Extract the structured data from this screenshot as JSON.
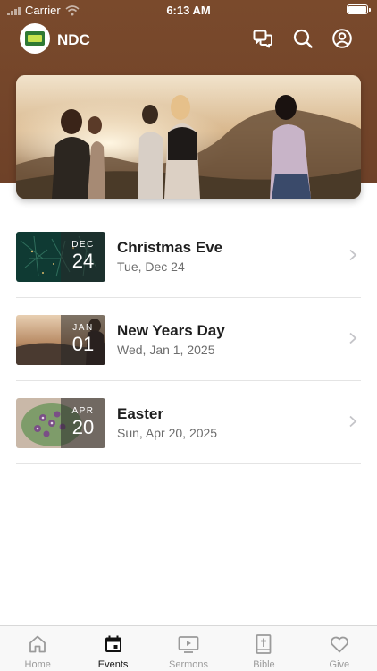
{
  "status_bar": {
    "carrier": "Carrier",
    "time": "6:13 AM"
  },
  "header": {
    "title": "NDC",
    "icons": [
      "chat-bubbles-icon",
      "search-icon",
      "account-icon"
    ]
  },
  "hero": {
    "image": "group-of-people-sunset-photo"
  },
  "events": [
    {
      "title": "Christmas Eve",
      "date": "Tue, Dec 24",
      "badge_month": "DEC",
      "badge_day": "24",
      "thumb": "pine-branches"
    },
    {
      "title": "New Years Day",
      "date": "Wed, Jan 1, 2025",
      "badge_month": "JAN",
      "badge_day": "01",
      "thumb": "sunset-silhouette"
    },
    {
      "title": "Easter",
      "date": "Sun, Apr 20, 2025",
      "badge_month": "APR",
      "badge_day": "20",
      "thumb": "flowers-on-plate"
    }
  ],
  "tabs": [
    {
      "label": "Home",
      "icon": "home-icon",
      "active": false
    },
    {
      "label": "Events",
      "icon": "calendar-icon",
      "active": true
    },
    {
      "label": "Sermons",
      "icon": "video-icon",
      "active": false
    },
    {
      "label": "Bible",
      "icon": "bible-icon",
      "active": false
    },
    {
      "label": "Give",
      "icon": "heart-icon",
      "active": false
    }
  ],
  "colors": {
    "header_brown": "#7a4a2c",
    "tab_active": "#111111",
    "tab_inactive": "#9b9b9b"
  }
}
